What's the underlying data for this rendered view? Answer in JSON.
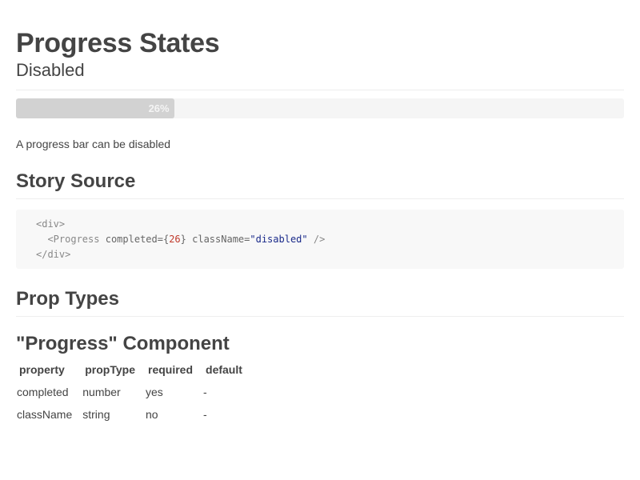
{
  "header": {
    "title": "Progress States",
    "subtitle": "Disabled"
  },
  "progress": {
    "completed": 26,
    "label": "26%",
    "fill_color": "#d2d2d2",
    "track_color": "#f5f5f5",
    "disabled": true
  },
  "description": "A progress bar can be disabled",
  "story_source": {
    "heading": "Story Source",
    "lines": [
      {
        "open_tag": "<div>"
      },
      {
        "tag_start": "<Progress",
        "attr1": "completed=",
        "brace_open": "{",
        "num": "26",
        "brace_close": "}",
        "attr2": "className=",
        "str": "\"disabled\"",
        "tag_end": "/>"
      },
      {
        "close_tag": "</div>"
      }
    ]
  },
  "prop_types": {
    "heading": "Prop Types",
    "component_heading": "\"Progress\" Component",
    "columns": [
      "property",
      "propType",
      "required",
      "default"
    ],
    "rows": [
      [
        "completed",
        "number",
        "yes",
        "-"
      ],
      [
        "className",
        "string",
        "no",
        "-"
      ]
    ]
  }
}
